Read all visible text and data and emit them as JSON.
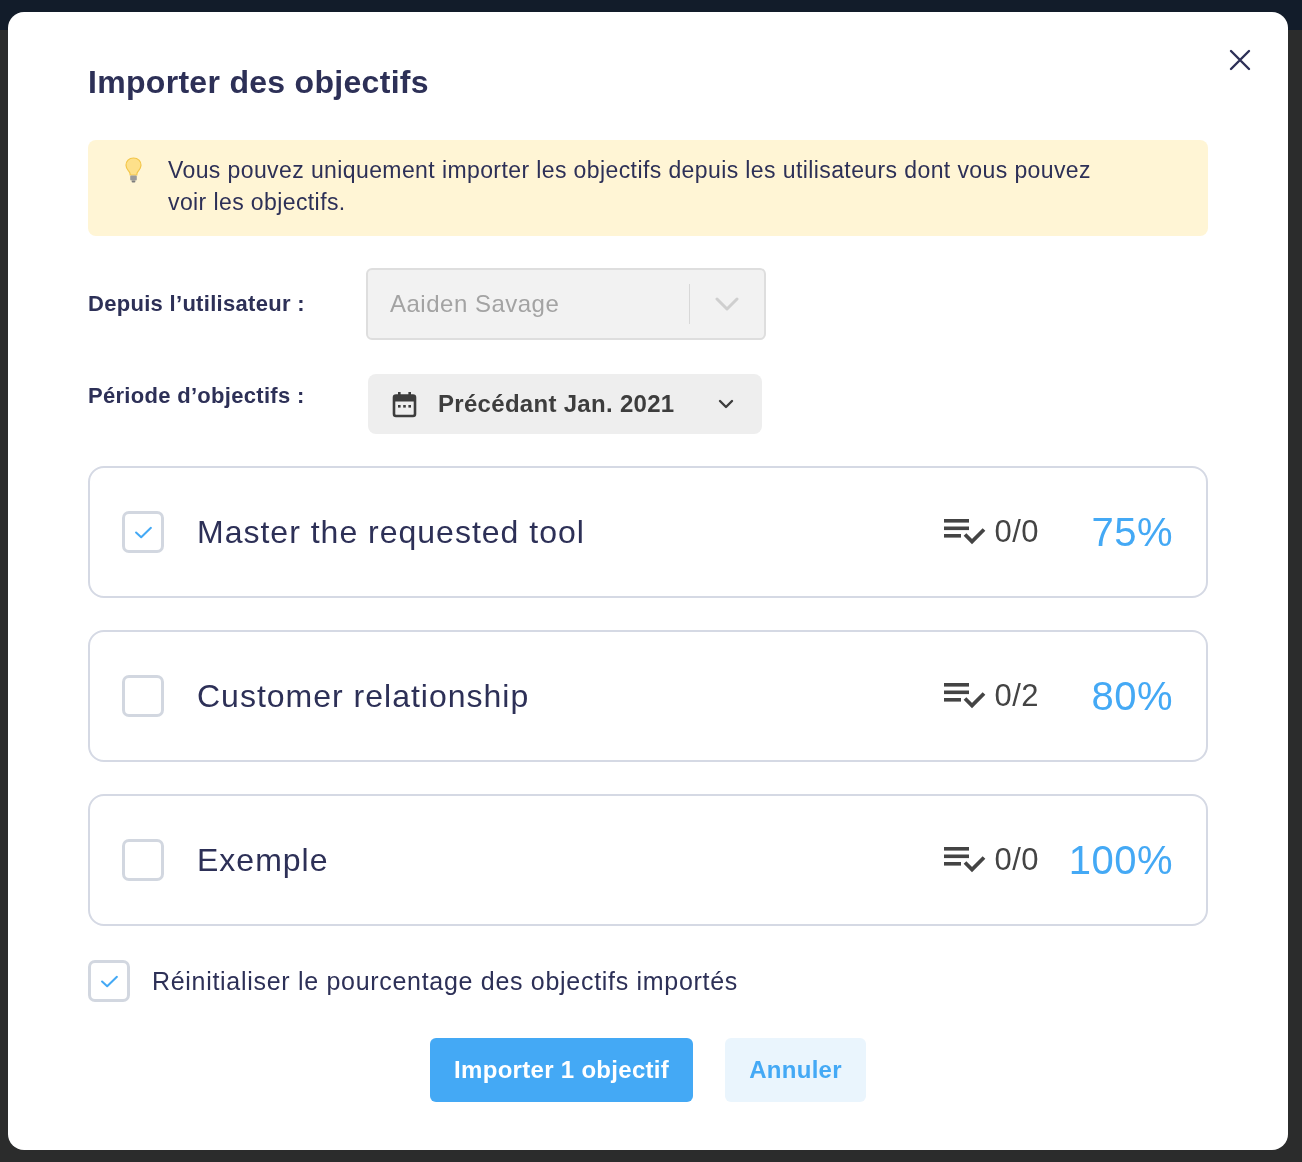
{
  "dialog": {
    "title": "Importer des objectifs",
    "info": "Vous pouvez uniquement importer les objectifs depuis les utilisateurs dont vous pouvez voir les objectifs.",
    "fields": [
      {
        "kind": "select",
        "label": "Depuis l’utilisateur :",
        "value": "Aaiden Savage",
        "disabled": true
      },
      {
        "kind": "period",
        "label": "Période d’objectifs :",
        "value": "Précédant Jan. 2021"
      }
    ],
    "objectives": [
      {
        "title": "Master the requested tool",
        "checked": true,
        "tasks": "0/0",
        "progress": "75%"
      },
      {
        "title": "Customer relationship",
        "checked": false,
        "tasks": "0/2",
        "progress": "80%"
      },
      {
        "title": "Exemple",
        "checked": false,
        "tasks": "0/0",
        "progress": "100%"
      }
    ],
    "reset_option": {
      "label": "Réinitialiser le pourcentage des objectifs importés",
      "checked": true
    },
    "buttons": [
      {
        "kind": "primary",
        "label": "Importer 1 objectif"
      },
      {
        "kind": "secondary",
        "label": "Annuler"
      }
    ]
  }
}
